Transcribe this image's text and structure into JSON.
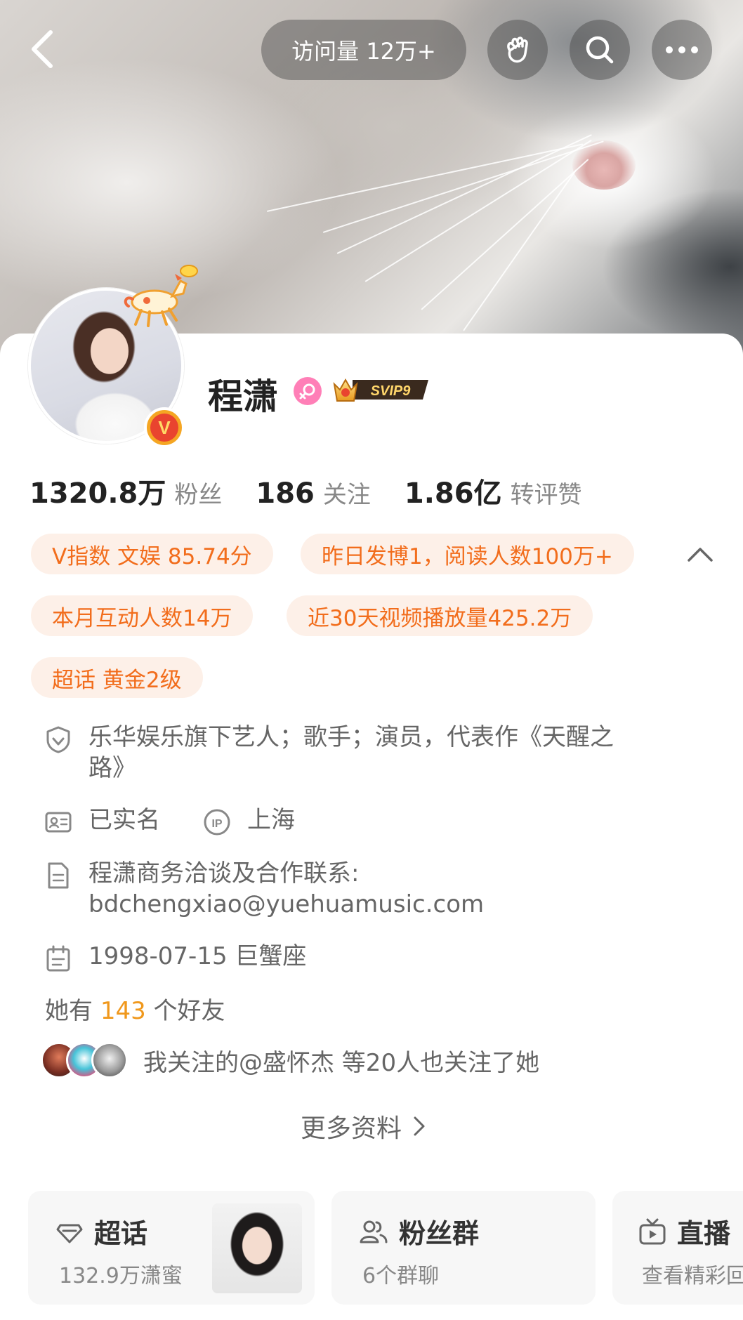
{
  "header": {
    "visits_label": "访问量 12万+"
  },
  "profile": {
    "name": "程潇",
    "vip_label": "SVIP9",
    "avatar_badge": "V"
  },
  "stats": [
    {
      "value": "1320.8万",
      "label": "粉丝"
    },
    {
      "value": "186",
      "label": "关注"
    },
    {
      "value": "1.86亿",
      "label": "转评赞"
    }
  ],
  "chips": [
    "V指数 文娱 85.74分",
    "昨日发博1，阅读人数100万+",
    "本月互动人数14万",
    "近30天视频播放量425.2万",
    "超话 黄金2级"
  ],
  "info": {
    "bio": "乐华娱乐旗下艺人；歌手；演员，代表作《天醒之路》",
    "bio_line1": "乐华娱乐旗下艺人；歌手；演员，代表作《天醒之",
    "bio_line2": "路》",
    "verified": "已实名",
    "ip_location": "上海",
    "contact_line1": "程潇商务洽谈及合作联系:",
    "contact_line2": "bdchengxiao@yuehuamusic.com",
    "birthday": "1998-07-15 巨蟹座"
  },
  "friends": {
    "prefix": "她有 ",
    "count": "143",
    "suffix": " 个好友"
  },
  "mutual": "我关注的@盛怀杰 等20人也关注了她",
  "more_info": "更多资料",
  "tiles": [
    {
      "title": "超话",
      "subtitle": "132.9万潇蜜"
    },
    {
      "title": "粉丝群",
      "subtitle": "6个群聊"
    },
    {
      "title": "直播",
      "subtitle": "查看精彩回"
    }
  ],
  "colors": {
    "accent_orange": "#f26d1c",
    "chip_bg": "#fdf0e8",
    "friend_count": "#f0981c",
    "gender_pink": "#ff7fb7"
  }
}
